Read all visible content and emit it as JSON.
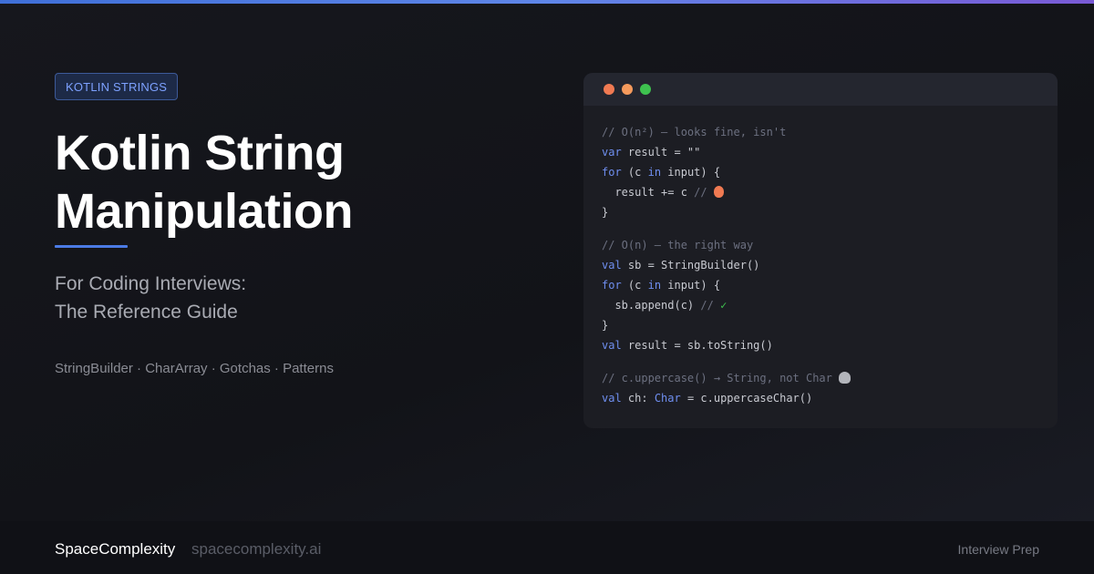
{
  "badge": {
    "label": "KOTLIN STRINGS"
  },
  "title": {
    "line1": "Kotlin String",
    "line2": "Manipulation"
  },
  "subtitle": {
    "line1": "For Coding Interviews:",
    "line2": "The Reference Guide"
  },
  "tags": "StringBuilder · CharArray · Gotchas · Patterns",
  "code": {
    "block1": {
      "comment": "// O(n²) — looks fine, isn't",
      "l2_kw": "var",
      "l2_rest": " result = \"\"",
      "l3_kw": "for",
      "l3_a": " (c ",
      "l3_kw2": "in",
      "l3_b": " input) {",
      "l4_code": "  result += c ",
      "l4_comment": "// ",
      "l4_icon": "flame-icon",
      "l5": "}"
    },
    "block2": {
      "comment": "// O(n) — the right way",
      "l2_kw": "val",
      "l2_rest": " sb = StringBuilder()",
      "l3_kw": "for",
      "l3_a": " (c ",
      "l3_kw2": "in",
      "l3_b": " input) {",
      "l4_code": "  sb.append(c) ",
      "l4_comment": "// ",
      "l4_check": "✓",
      "l5": "}",
      "l6_kw": "val",
      "l6_rest": " result = sb.toString()"
    },
    "block3": {
      "comment": "// c.uppercase() → String, not Char ",
      "comment_icon": "skull-icon",
      "l2_kw": "val",
      "l2_a": " ch: ",
      "l2_type": "Char",
      "l2_b": " = c.uppercaseChar()"
    }
  },
  "footer": {
    "brand": "SpaceComplexity",
    "url": "spacecomplexity.ai",
    "tag": "Interview Prep"
  },
  "colors": {
    "accent": "#4b7be5",
    "badge_text": "#7da1ff",
    "keyword": "#6f8ff0",
    "comment": "#6c7080",
    "check": "#3ec24f",
    "dot_red": "#f07a52",
    "dot_orange": "#f59a5c",
    "dot_green": "#3ec24f"
  }
}
